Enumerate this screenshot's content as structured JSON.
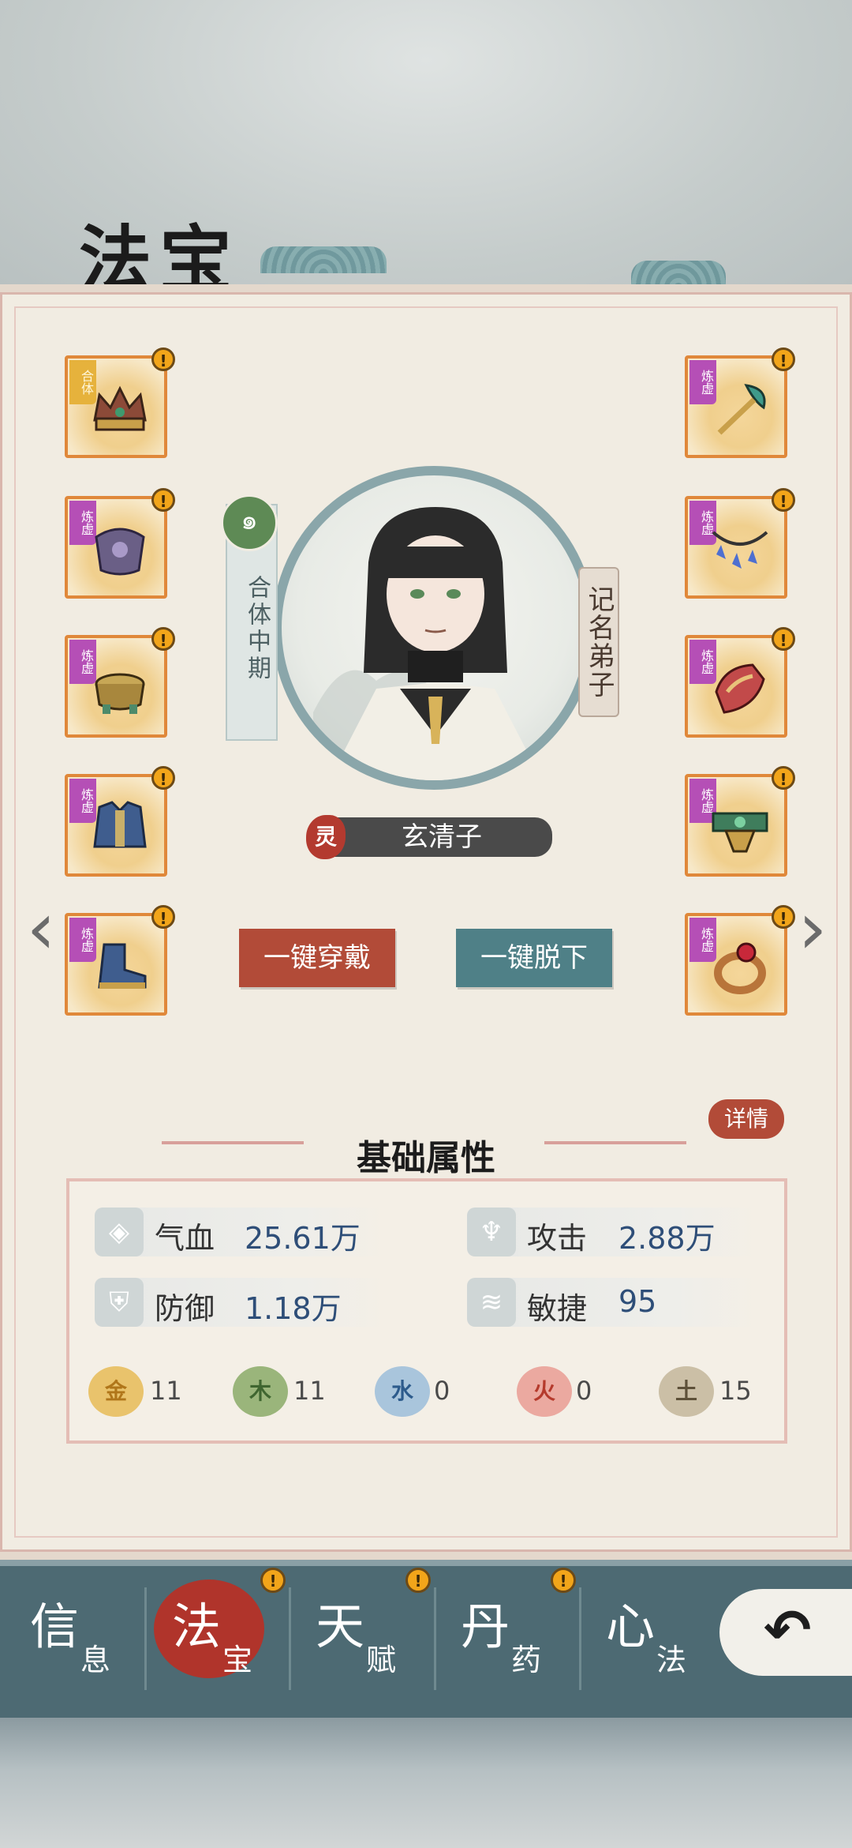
{
  "title": "法宝",
  "left_slots": [
    {
      "tag": "合体",
      "tag_color": "gold",
      "art": "crown-icon"
    },
    {
      "tag": "炼虚",
      "tag_color": "purple",
      "art": "chest-armor-icon"
    },
    {
      "tag": "炼虚",
      "tag_color": "purple",
      "art": "bracelet-icon"
    },
    {
      "tag": "炼虚",
      "tag_color": "purple",
      "art": "robe-icon"
    },
    {
      "tag": "炼虚",
      "tag_color": "purple",
      "art": "boot-icon"
    }
  ],
  "right_slots": [
    {
      "tag": "炼虚",
      "tag_color": "purple",
      "art": "fan-staff-icon"
    },
    {
      "tag": "炼虚",
      "tag_color": "purple",
      "art": "necklace-icon"
    },
    {
      "tag": "炼虚",
      "tag_color": "purple",
      "art": "shoulder-armor-icon"
    },
    {
      "tag": "炼虚",
      "tag_color": "purple",
      "art": "belt-icon"
    },
    {
      "tag": "炼虚",
      "tag_color": "purple",
      "art": "ring-icon"
    }
  ],
  "alert_mark": "!",
  "character": {
    "realm": "合体中期",
    "realm_icon": "๑",
    "rank": "记名弟子",
    "spirit": "灵",
    "name": "玄清子"
  },
  "buttons": {
    "equip_all": "一键穿戴",
    "unequip_all": "一键脱下"
  },
  "nav_arrows": {
    "left": "‹",
    "right": "›"
  },
  "details_label": "详情",
  "section_title": "基础属性",
  "stats": [
    {
      "label": "气血",
      "value": "25.61万",
      "icon": "blood-drop-icon",
      "glyph": "◈"
    },
    {
      "label": "攻击",
      "value": "2.88万",
      "icon": "attack-icon",
      "glyph": "♆"
    },
    {
      "label": "防御",
      "value": "1.18万",
      "icon": "shield-icon",
      "glyph": "⛨"
    },
    {
      "label": "敏捷",
      "value": "95",
      "icon": "wing-icon",
      "glyph": "≋"
    }
  ],
  "elements": [
    {
      "name": "金",
      "value": "11",
      "color": "#e9c36c",
      "text_color": "#b0761a"
    },
    {
      "name": "木",
      "value": "11",
      "color": "#9ab57b",
      "text_color": "#3f6630"
    },
    {
      "name": "水",
      "value": "0",
      "color": "#a9c5dc",
      "text_color": "#2d5b8c"
    },
    {
      "name": "火",
      "value": "0",
      "color": "#eba9a0",
      "text_color": "#b53a2c"
    },
    {
      "name": "土",
      "value": "15",
      "color": "#cbbfa6",
      "text_color": "#5e5139"
    }
  ],
  "tabs": [
    {
      "big": "信",
      "small": "息"
    },
    {
      "big": "法",
      "small": "宝"
    },
    {
      "big": "天",
      "small": "赋"
    },
    {
      "big": "丹",
      "small": "药"
    },
    {
      "big": "心",
      "small": "法"
    }
  ],
  "back_icon": "↶"
}
